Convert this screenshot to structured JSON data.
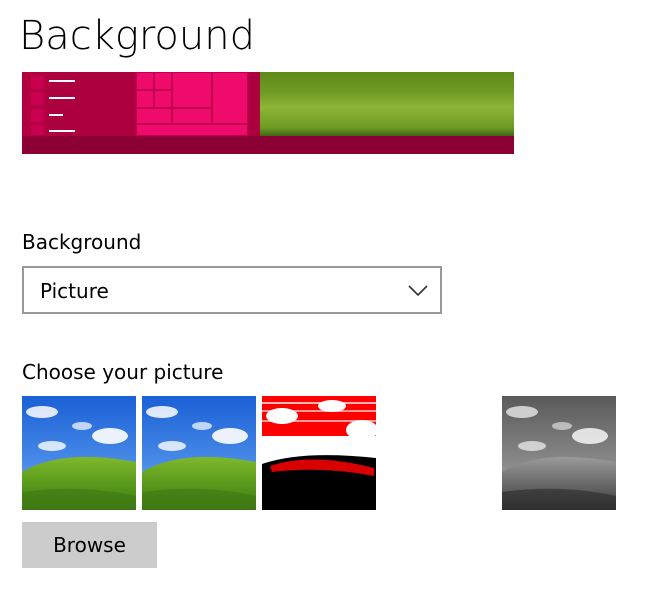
{
  "page": {
    "title": "Background"
  },
  "preview": {
    "accent_color": "#e0005e",
    "taskbar_color": "#8c0034"
  },
  "background_setting": {
    "label": "Background",
    "selected_value": "Picture"
  },
  "picture_chooser": {
    "label": "Choose your picture",
    "thumbnails": [
      {
        "name": "bliss-color"
      },
      {
        "name": "bliss-color"
      },
      {
        "name": "bliss-red-posterized"
      },
      {
        "name": "blank"
      },
      {
        "name": "bliss-grayscale"
      }
    ],
    "browse_label": "Browse"
  }
}
